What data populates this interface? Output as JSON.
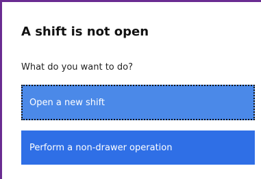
{
  "dialog": {
    "title": "A shift is not open",
    "prompt": "What do you want to do?",
    "options": [
      {
        "label": "Open a new shift",
        "focused": true
      },
      {
        "label": "Perform a non-drawer operation",
        "focused": false
      }
    ]
  },
  "colors": {
    "frame_accent": "#6a2c91",
    "button_focused": "#4b89e8",
    "button_primary": "#2f6fe6"
  }
}
